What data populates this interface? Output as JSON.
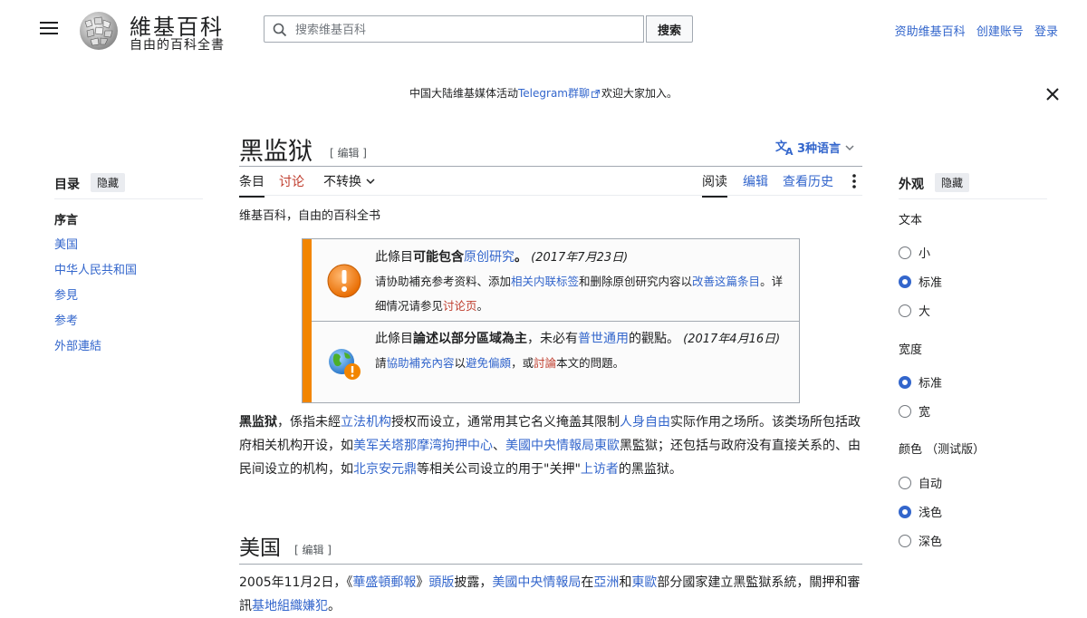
{
  "header": {
    "wordmark": "維基百科",
    "tagline": "自由的百科全書",
    "search_placeholder": "搜索维基百科",
    "search_button": "搜索",
    "user_links": [
      "资助维基百科",
      "创建账号",
      "登录"
    ]
  },
  "banner": {
    "prefix": "中国大陆维基媒体活动",
    "link": "Telegram群聊",
    "suffix": "欢迎大家加入。"
  },
  "article": {
    "title": "黑监狱",
    "title_edit": "[ 编辑 ]",
    "languages": "3种语言",
    "tabs_left": [
      "条目",
      "讨论",
      "不转换"
    ],
    "tabs_right": [
      "阅读",
      "编辑",
      "查看历史"
    ],
    "site_sub": "维基百科，自由的百科全书"
  },
  "ambox1": {
    "lead_a": "此條目",
    "lead_b": "可能包含",
    "lead_link": "原创研究",
    "lead_c": "。",
    "date": "(2017年7月23日)",
    "line2_a": "请协助補充参考资料、添加",
    "line2_link1": "相关内联标签",
    "line2_b": "和删除原创研究内容以",
    "line2_link2": "改善这篇条目",
    "line2_c": "。详细情况请参见",
    "line2_link3": "讨论页",
    "line2_d": "。"
  },
  "ambox2": {
    "lead_a": "此條目",
    "lead_b": "論述以部分區域為主",
    "lead_c": "，未必有",
    "lead_link": "普世通用",
    "lead_d": "的觀點。",
    "date": "(2017年4月16日)",
    "line2_a": "請",
    "line2_link1": "協助補充內容",
    "line2_b": "以",
    "line2_link2": "避免偏頗",
    "line2_c": "，或",
    "line2_link3": "討論",
    "line2_d": "本文的問題。"
  },
  "intro": {
    "t1": "黑监狱",
    "t2": "，係指未經",
    "l1": "立法机构",
    "t3": "授权而设立，通常用其它名义掩盖其限制",
    "l2": "人身自由",
    "t4": "实际作用之场所。该类场所包括政府相关机构开设，如",
    "l3": "美军关塔那摩湾拘押中心",
    "t5": "、",
    "l4": "美國中央情報局東歐",
    "t6": "黑監獄；还包括与政府没有直接关系的、由民间设立的机构，如",
    "l5": "北京安元鼎",
    "t7": "等相关公司设立的用于\"关押\"",
    "l6": "上访者",
    "t8": "的黑监狱。"
  },
  "section_usa": {
    "heading": "美国",
    "edit": "[ 编辑 ]",
    "t1": "2005年11月2日，《",
    "l1": "華盛頓郵報",
    "t2": "》",
    "l2": "頭版",
    "t3": "披露，",
    "l3": "美國中央情報局",
    "t4": "在",
    "l4": "亞洲",
    "t5": "和",
    "l5": "東歐",
    "t6": "部分國家建立黑監獄系統，關押和審訊",
    "l6": "基地組織嫌犯",
    "t7": "。"
  },
  "toc": {
    "title": "目录",
    "hide": "隐藏",
    "items": [
      "序言",
      "美国",
      "中华人民共和国",
      "参見",
      "参考",
      "外部連結"
    ]
  },
  "appearance": {
    "title": "外观",
    "hide": "隐藏",
    "text_label": "文本",
    "text_options": [
      "小",
      "标准",
      "大"
    ],
    "text_selected": "标准",
    "width_label": "宽度",
    "width_options": [
      "标准",
      "宽"
    ],
    "width_selected": "标准",
    "color_label": "颜色 （测试版）",
    "color_options": [
      "自动",
      "浅色",
      "深色"
    ],
    "color_selected": "浅色"
  },
  "colors": {
    "link": "#3366cc",
    "redlink": "#bf3c2c",
    "ambox_bar": "#f28500"
  }
}
